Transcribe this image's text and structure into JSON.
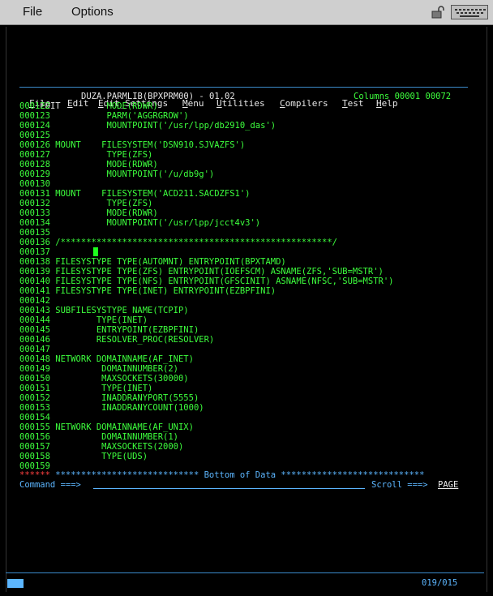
{
  "menubar": {
    "file": "File",
    "options": "Options"
  },
  "pulldown": {
    "items": [
      {
        "hot": "F",
        "rest": "ile"
      },
      {
        "hot": "E",
        "rest": "dit"
      },
      {
        "hot": "E",
        "rest": "dit_Settings"
      },
      {
        "hot": "M",
        "rest": "enu"
      },
      {
        "hot": "U",
        "rest": "tilities"
      },
      {
        "hot": "C",
        "rest": "ompilers"
      },
      {
        "hot": "T",
        "rest": "est"
      },
      {
        "hot": "H",
        "rest": "elp"
      }
    ]
  },
  "header": {
    "mode": "EDIT",
    "dataset": "DUZA.PARMLIB(BPXPRM00) - 01.02",
    "columns": "Columns 00001 00072"
  },
  "lines": [
    {
      "num": "000122",
      "text": "          MODE(RDWR)"
    },
    {
      "num": "000123",
      "text": "          PARM('AGGRGROW')"
    },
    {
      "num": "000124",
      "text": "          MOUNTPOINT('/usr/lpp/db2910_das')"
    },
    {
      "num": "000125",
      "text": ""
    },
    {
      "num": "000126",
      "text": "MOUNT    FILESYSTEM('DSN910.SJVAZFS')"
    },
    {
      "num": "000127",
      "text": "          TYPE(ZFS)"
    },
    {
      "num": "000128",
      "text": "          MODE(RDWR)"
    },
    {
      "num": "000129",
      "text": "          MOUNTPOINT('/u/db9g')"
    },
    {
      "num": "000130",
      "text": ""
    },
    {
      "num": "000131",
      "text": "MOUNT    FILESYSTEM('ACD211.SACDZFS1')"
    },
    {
      "num": "000132",
      "text": "          TYPE(ZFS)"
    },
    {
      "num": "000133",
      "text": "          MODE(RDWR)"
    },
    {
      "num": "000134",
      "text": "          MOUNTPOINT('/usr/lpp/jcct4v3')"
    },
    {
      "num": "000135",
      "text": ""
    },
    {
      "num": "000136",
      "text": "/*****************************************************/"
    },
    {
      "num": "000137",
      "text": ""
    },
    {
      "num": "000138",
      "text": "FILESYSTYPE TYPE(AUTOMNT) ENTRYPOINT(BPXTAMD)"
    },
    {
      "num": "000139",
      "text": "FILESYSTYPE TYPE(ZFS) ENTRYPOINT(IOEFSCM) ASNAME(ZFS,'SUB=MSTR')"
    },
    {
      "num": "000140",
      "text": "FILESYSTYPE TYPE(NFS) ENTRYPOINT(GFSCINIT) ASNAME(NFSC,'SUB=MSTR')"
    },
    {
      "num": "000141",
      "text": "FILESYSTYPE TYPE(INET) ENTRYPOINT(EZBPFINI)"
    },
    {
      "num": "000142",
      "text": ""
    },
    {
      "num": "000143",
      "text": "SUBFILESYSTYPE NAME(TCPIP)"
    },
    {
      "num": "000144",
      "text": "        TYPE(INET)"
    },
    {
      "num": "000145",
      "text": "        ENTRYPOINT(EZBPFINI)"
    },
    {
      "num": "000146",
      "text": "        RESOLVER_PROC(RESOLVER)"
    },
    {
      "num": "000147",
      "text": ""
    },
    {
      "num": "000148",
      "text": "NETWORK DOMAINNAME(AF_INET)"
    },
    {
      "num": "000149",
      "text": "         DOMAINNUMBER(2)"
    },
    {
      "num": "000150",
      "text": "         MAXSOCKETS(30000)"
    },
    {
      "num": "000151",
      "text": "         TYPE(INET)"
    },
    {
      "num": "000152",
      "text": "         INADDRANYPORT(5555)"
    },
    {
      "num": "000153",
      "text": "         INADDRANYCOUNT(1000)"
    },
    {
      "num": "000154",
      "text": ""
    },
    {
      "num": "000155",
      "text": "NETWORK DOMAINNAME(AF_UNIX)"
    },
    {
      "num": "000156",
      "text": "         DOMAINNUMBER(1)"
    },
    {
      "num": "000157",
      "text": "         MAXSOCKETS(2000)"
    },
    {
      "num": "000158",
      "text": "         TYPE(UDS)"
    },
    {
      "num": "000159",
      "text": ""
    }
  ],
  "bottom": {
    "stars": "******",
    "text": " **************************** Bottom of Data ****************************"
  },
  "command": {
    "label": "Command ===>",
    "value": "",
    "scroll_label": "Scroll ===>",
    "scroll_value": "PAGE"
  },
  "status": {
    "cursor_pos": "019/015"
  },
  "colors": {
    "background": "#000000",
    "text_green": "#3dff3d",
    "text_blue": "#5cb6ff",
    "text_red": "#ff4040",
    "menubar": "#cfcfcf"
  }
}
